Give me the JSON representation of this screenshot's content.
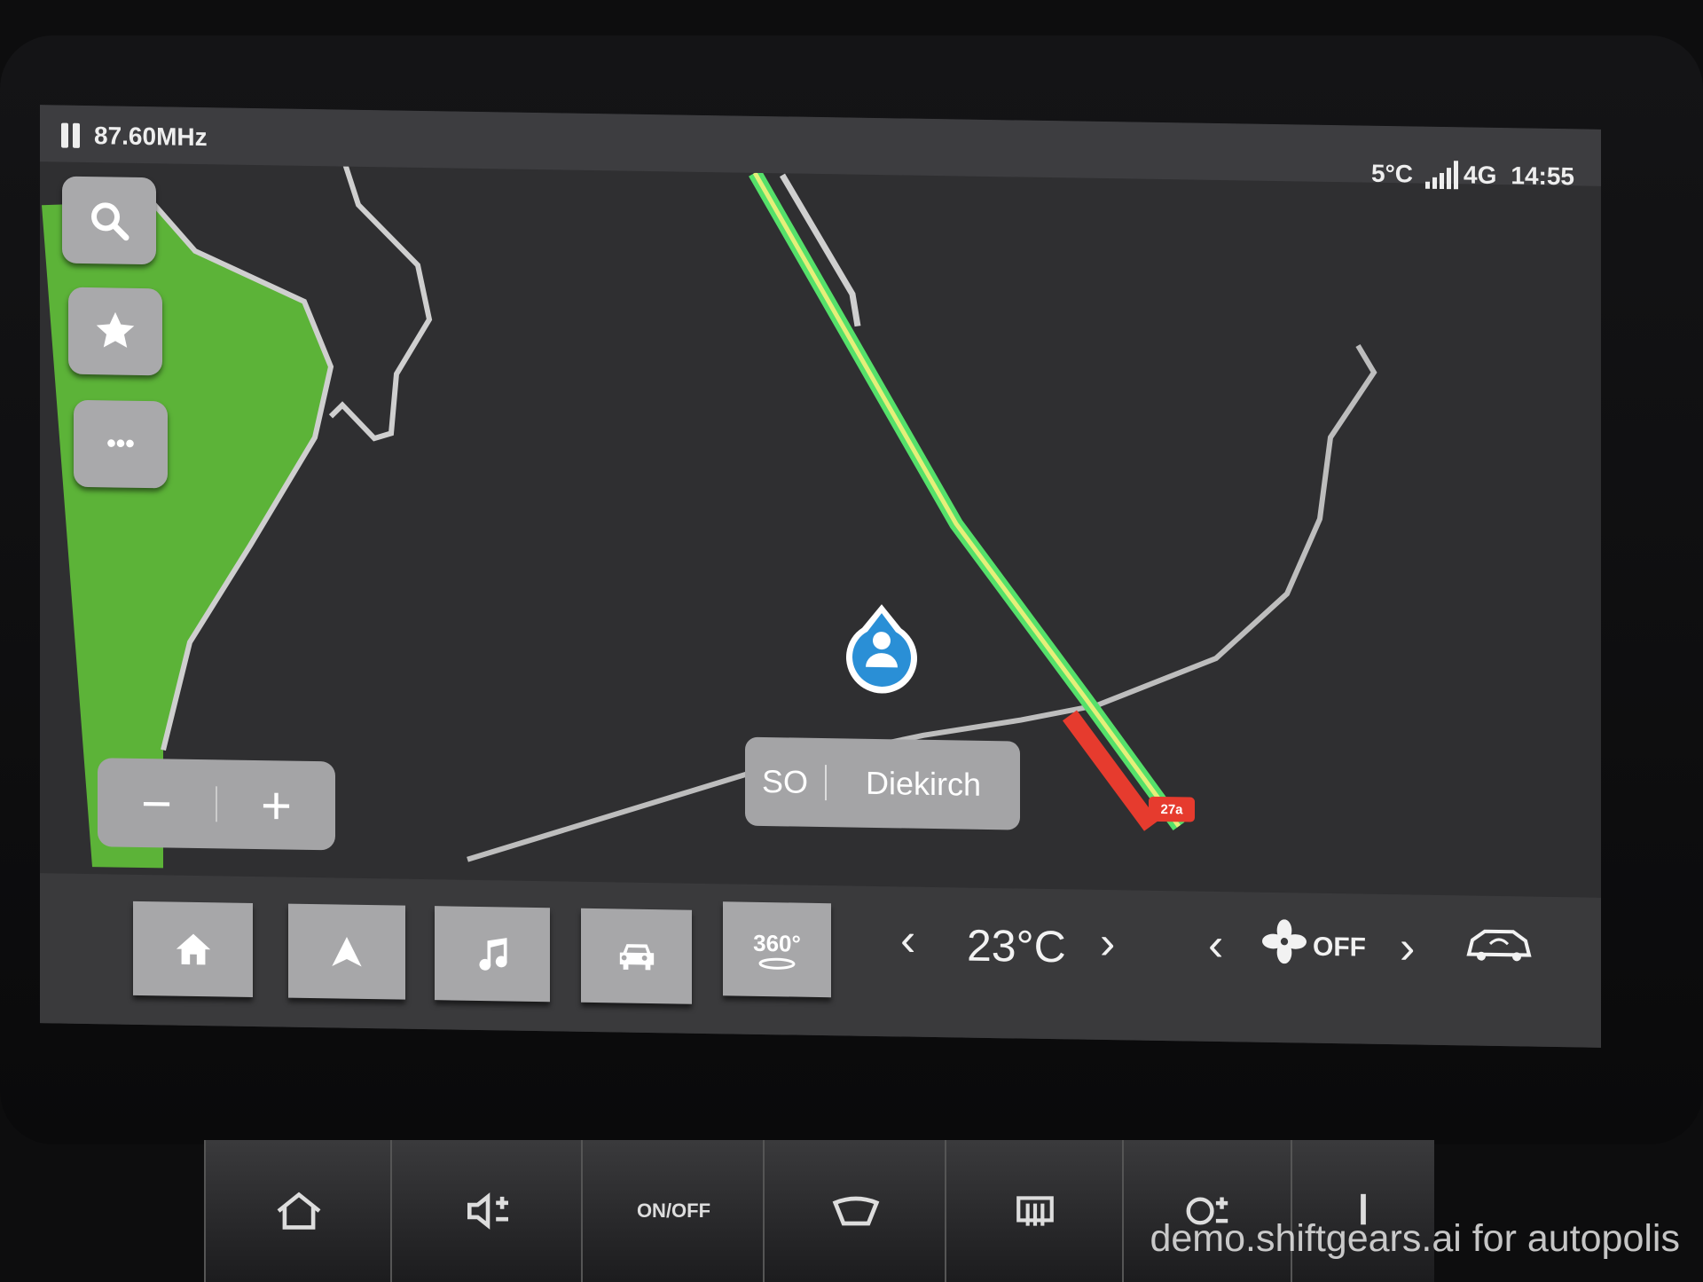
{
  "status_bar": {
    "radio_frequency": "87.60MHz",
    "outside_temp": "5°C",
    "network": "4G",
    "time": "14:55",
    "signal_bars": 5
  },
  "map": {
    "search_icon": "search-icon",
    "favorite_icon": "star-icon",
    "more_icon": "more-dots-icon",
    "more_label": "•••",
    "zoom_out_label": "−",
    "zoom_in_label": "+",
    "heading": "SO",
    "current_place": "Diekirch",
    "exit_badge": "27a",
    "colors": {
      "land": "#5cb338",
      "route": "#55e06a",
      "route_core": "#e5ef7a",
      "traffic": "#e63b2e",
      "road": "#bdbdbd"
    }
  },
  "dock": {
    "home_icon": "home-icon",
    "nav_icon": "navigation-arrow-icon",
    "music_icon": "music-note-icon",
    "car_icon": "car-icon",
    "camera_label": "360°",
    "temp_down": "‹",
    "temperature": "23°C",
    "temp_up": "›",
    "fan_down": "‹",
    "fan_state": "OFF",
    "fan_up": "›",
    "recirculation_icon": "car-air-recirculation-icon"
  },
  "physical_buttons": {
    "home": "home-icon",
    "volume": "volume-icon",
    "ac_toggle": "ON/OFF",
    "defrost_front": "defrost-front-icon",
    "defrost_rear": "defrost-rear-icon",
    "fan_plus": "fan-speed-icon",
    "seat_heat": "seat-heat-icon"
  },
  "watermark": "demo.shiftgears.ai for autopolis"
}
